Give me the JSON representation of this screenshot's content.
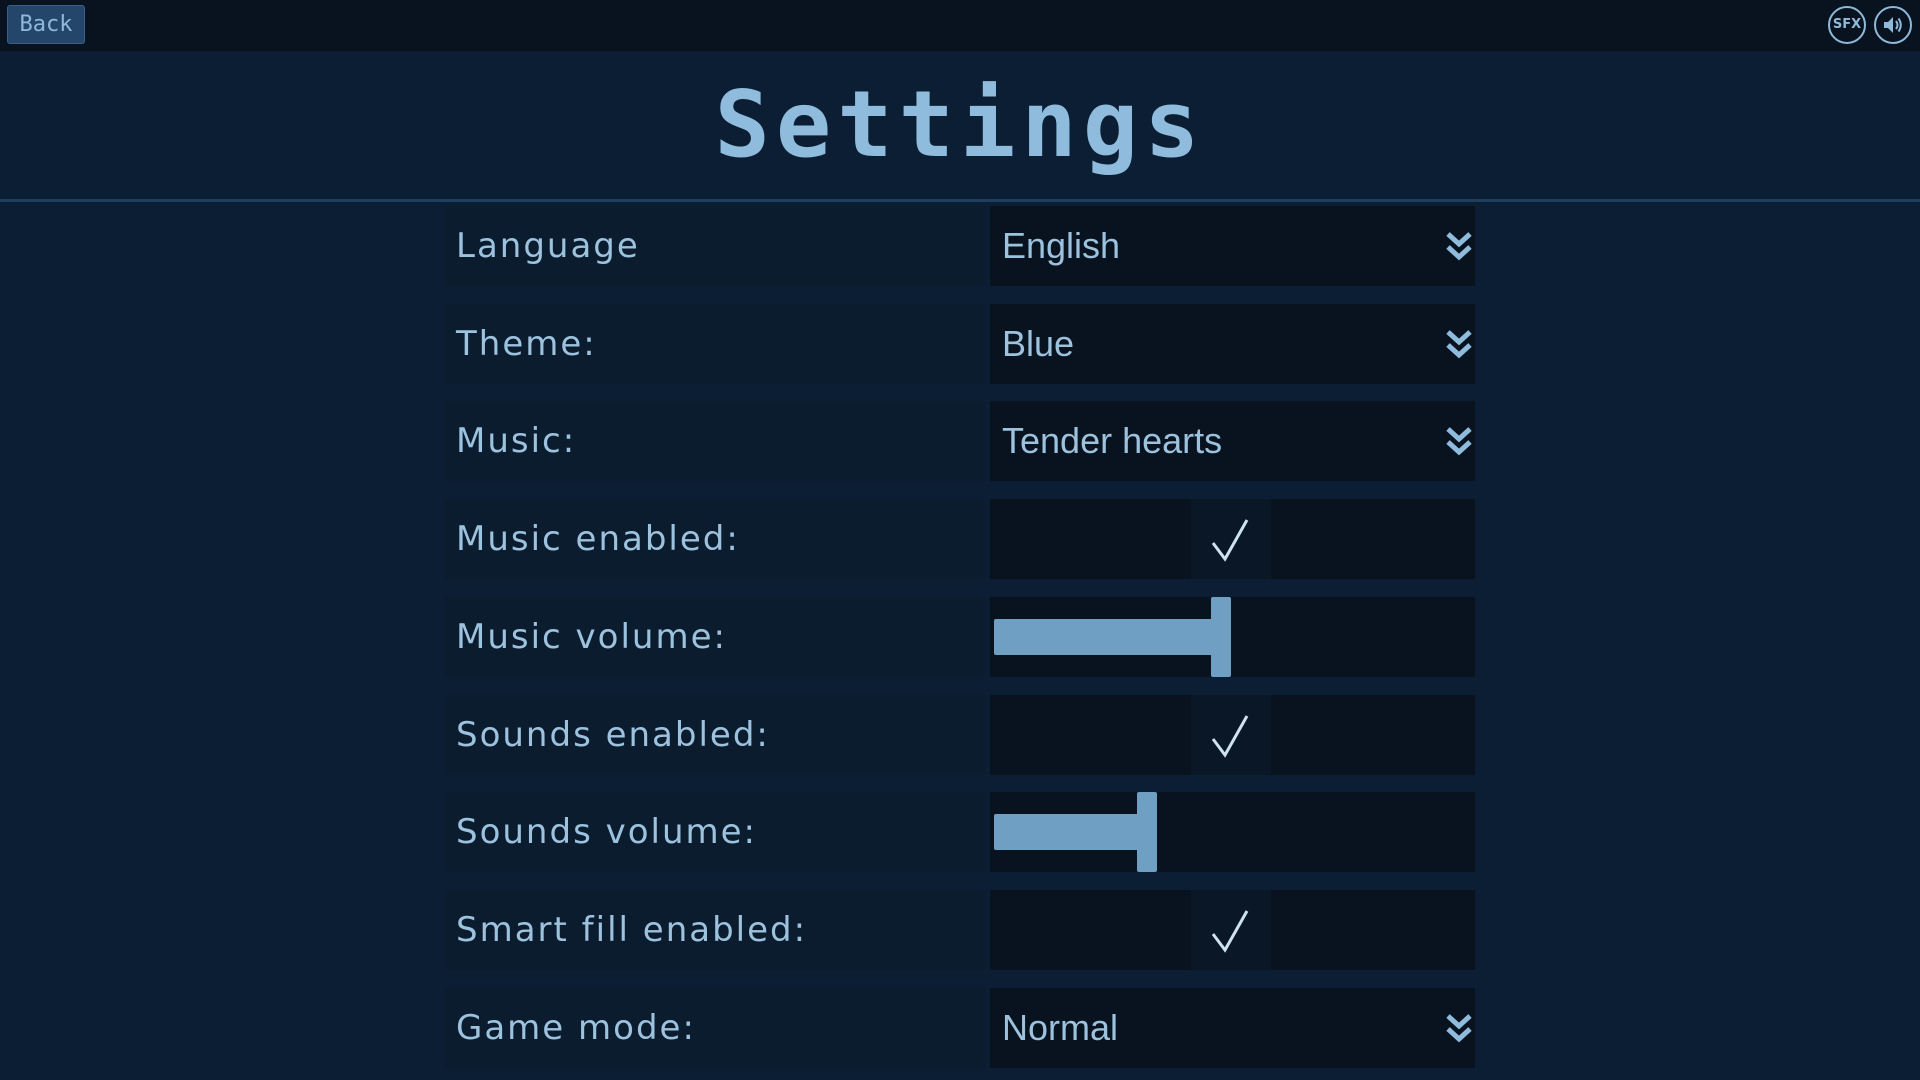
{
  "topbar": {
    "back_label": "Back",
    "sfx_label": "SFX"
  },
  "title": "Settings",
  "settings": [
    {
      "label": "Language",
      "type": "dropdown",
      "value": "English"
    },
    {
      "label": "Theme:",
      "type": "dropdown",
      "value": "Blue"
    },
    {
      "label": "Music:",
      "type": "dropdown",
      "value": "Tender hearts"
    },
    {
      "label": "Music enabled:",
      "type": "checkbox",
      "checked": true
    },
    {
      "label": "Music volume:",
      "type": "slider",
      "value_fraction": 0.47
    },
    {
      "label": "Sounds enabled:",
      "type": "checkbox",
      "checked": true
    },
    {
      "label": "Sounds volume:",
      "type": "slider",
      "value_fraction": 0.31
    },
    {
      "label": "Smart fill enabled:",
      "type": "checkbox",
      "checked": true
    },
    {
      "label": "Game mode:",
      "type": "dropdown",
      "value": "Normal"
    }
  ],
  "icons": {
    "back": "back-button",
    "sfx": "sfx-icon",
    "sound": "speaker-icon",
    "dropdown": "double-chevron-down-icon",
    "checkbox": "checkmark-icon"
  },
  "colors": {
    "background": "#0b1e33",
    "topbar": "#08131f",
    "accent": "#8fbcdc",
    "slider": "#6f9fc3"
  }
}
